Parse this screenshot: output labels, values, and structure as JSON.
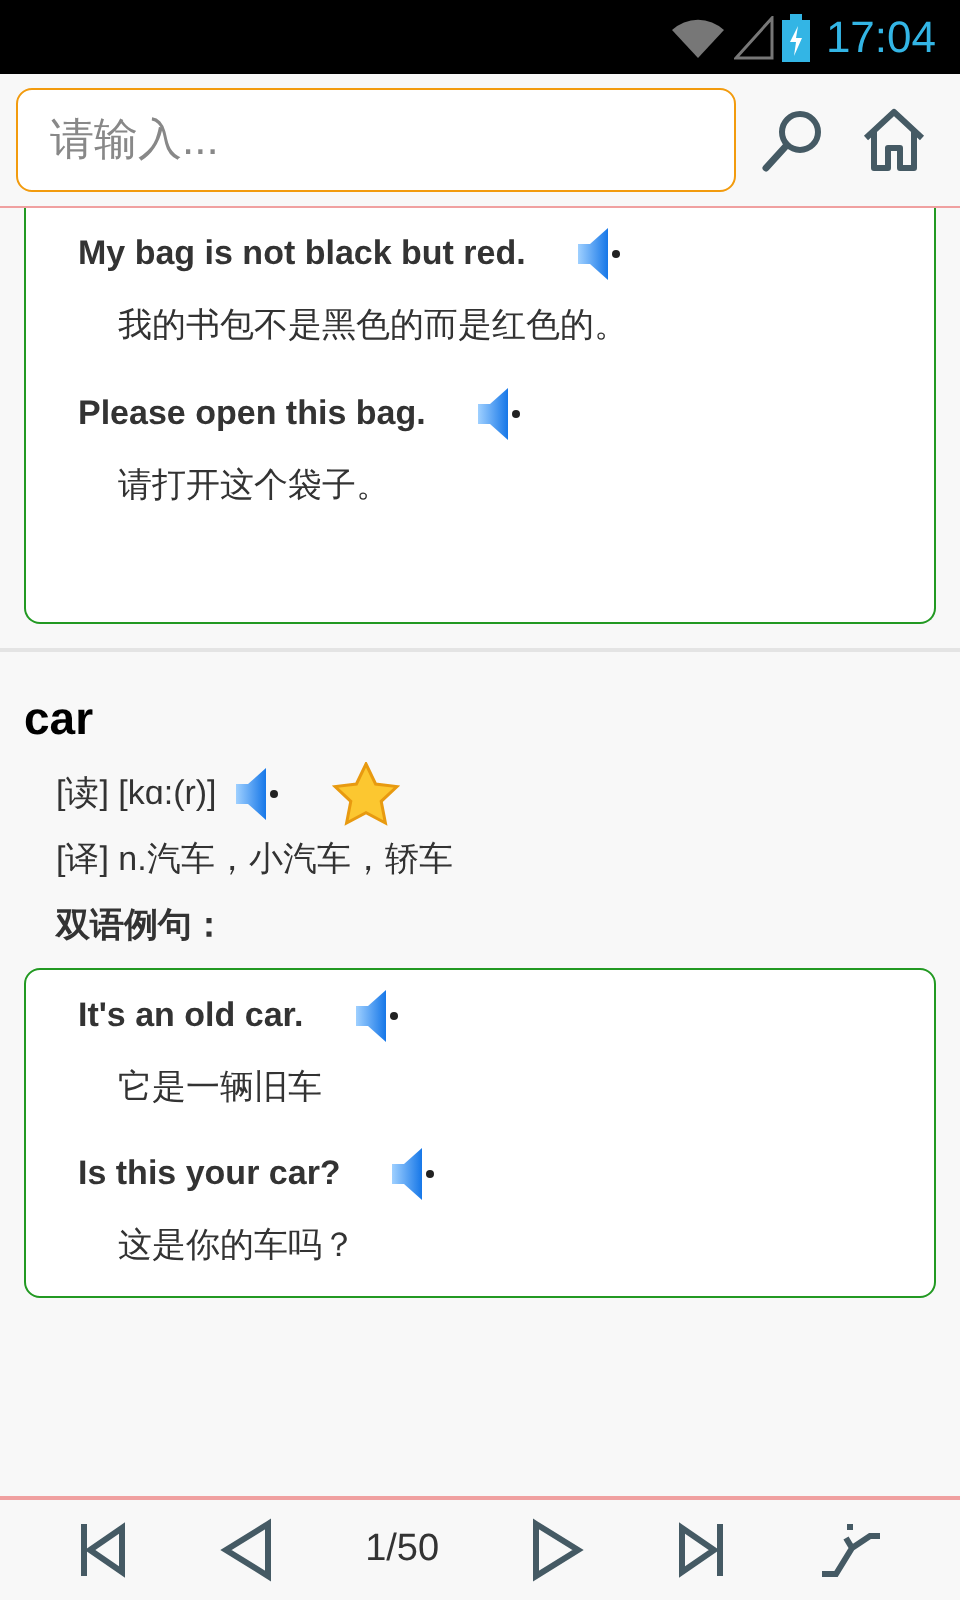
{
  "status_bar": {
    "time": "17:04"
  },
  "search": {
    "placeholder": "请输入..."
  },
  "entries": [
    {
      "examples": [
        {
          "en": "My bag is not black but red.",
          "zh": "我的书包不是黑色的而是红色的。"
        },
        {
          "en": "Please open this bag.",
          "zh": "请打开这个袋子。"
        }
      ]
    },
    {
      "word": "car",
      "pronunciation": "[读] [kɑ:(r)]",
      "favorite": true,
      "translation": "[译] n.汽车，小汽车，轿车",
      "examples_heading": "双语例句：",
      "examples": [
        {
          "en": "It's an old car.",
          "zh": "它是一辆旧车"
        },
        {
          "en": "Is this your car?",
          "zh": "这是你的车吗？"
        }
      ]
    }
  ],
  "pager": {
    "page": "1/50"
  }
}
